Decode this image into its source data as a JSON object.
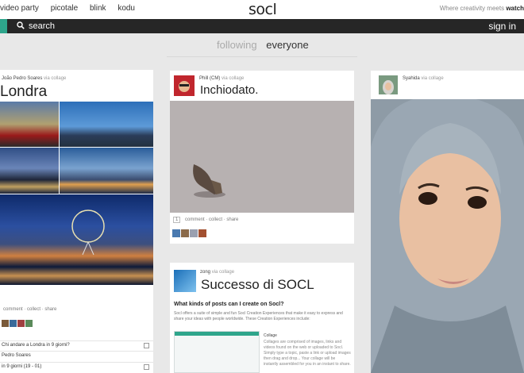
{
  "nav": {
    "links": [
      "video party",
      "picotale",
      "blink",
      "kodu"
    ],
    "logo": "socl",
    "tagline": "Where creativity meets",
    "tagline_bold": "watch"
  },
  "searchbar": {
    "label": "search",
    "signin": "sign in"
  },
  "tabs": {
    "following": "following",
    "everyone": "everyone"
  },
  "post1": {
    "author": "João Pedro Soares",
    "via": "via collage",
    "title": "Londra",
    "actions": "comment · collect · share",
    "comments": [
      "Chi andare a Londra in 9 giorni?",
      "Pedro Soares",
      "in 9 giorni (19 - 01)"
    ]
  },
  "post2": {
    "author": "Phill (CM)",
    "via": "via collage",
    "title": "Inchiodato.",
    "count": "1",
    "actions": "comment · collect · share"
  },
  "post3": {
    "author": "zong",
    "via": "via collage",
    "title": "Successo di SOCL",
    "heading": "What kinds of posts can I create on Socl?",
    "body": "Socl offers a suite of simple and fun Socl Creation Experiences that make it easy to express and share your ideas with people worldwide. These Creation Experiences include:",
    "collage_title": "Collage",
    "collage_body": "Collages are comprised of images, links and videos found on the web or uploaded to Socl. Simply type a topic, paste a link or upload images then drag and drop... Your collage will be instantly assembled for you in an instant to share."
  },
  "post4": {
    "author": "Syahida",
    "via": "via collage"
  },
  "colors": {
    "accent": "#2ea58b",
    "searchbar": "#262626"
  }
}
